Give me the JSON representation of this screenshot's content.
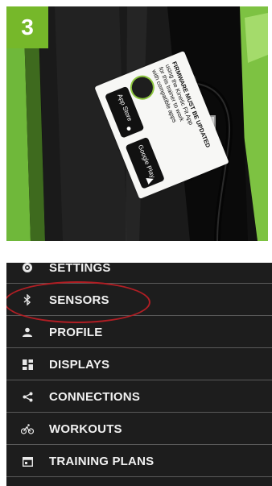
{
  "photo": {
    "step_number": "3",
    "sticker": {
      "headline": "FIRMWARE MUST BE UPDATED",
      "line2": "using the Kinetic Fit App",
      "line3": "for this trainer to work",
      "line4": "with compatible apps",
      "app_store_label": "App Store",
      "google_play_label": "Google Play"
    },
    "colors": {
      "badge_green": "#76b82a",
      "frame_green": "#7dc242",
      "led_yellow": "#d4ff2a"
    }
  },
  "menu": {
    "items": [
      {
        "label": "SETTINGS",
        "icon": "gear-icon"
      },
      {
        "label": "SENSORS",
        "icon": "bluetooth-icon"
      },
      {
        "label": "PROFILE",
        "icon": "person-icon"
      },
      {
        "label": "DISPLAYS",
        "icon": "dashboard-icon"
      },
      {
        "label": "CONNECTIONS",
        "icon": "share-icon"
      },
      {
        "label": "WORKOUTS",
        "icon": "bike-icon"
      },
      {
        "label": "TRAINING PLANS",
        "icon": "calendar-icon"
      }
    ],
    "highlight_color": "#b01e24",
    "background_color": "#1d1d1d"
  }
}
